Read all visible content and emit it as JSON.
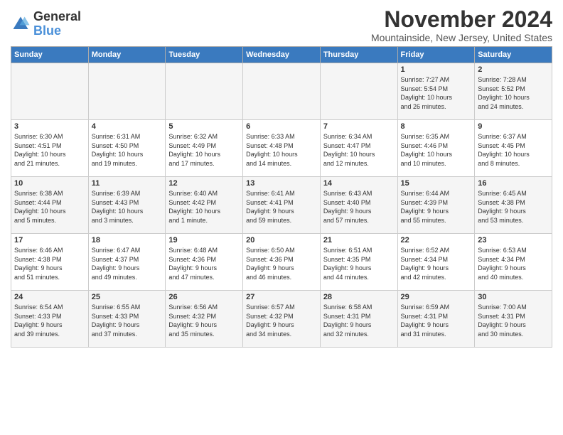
{
  "header": {
    "logo_line1": "General",
    "logo_line2": "Blue",
    "month": "November 2024",
    "location": "Mountainside, New Jersey, United States"
  },
  "days_of_week": [
    "Sunday",
    "Monday",
    "Tuesday",
    "Wednesday",
    "Thursday",
    "Friday",
    "Saturday"
  ],
  "weeks": [
    [
      {
        "day": "",
        "info": ""
      },
      {
        "day": "",
        "info": ""
      },
      {
        "day": "",
        "info": ""
      },
      {
        "day": "",
        "info": ""
      },
      {
        "day": "",
        "info": ""
      },
      {
        "day": "1",
        "info": "Sunrise: 7:27 AM\nSunset: 5:54 PM\nDaylight: 10 hours\nand 26 minutes."
      },
      {
        "day": "2",
        "info": "Sunrise: 7:28 AM\nSunset: 5:52 PM\nDaylight: 10 hours\nand 24 minutes."
      }
    ],
    [
      {
        "day": "3",
        "info": "Sunrise: 6:30 AM\nSunset: 4:51 PM\nDaylight: 10 hours\nand 21 minutes."
      },
      {
        "day": "4",
        "info": "Sunrise: 6:31 AM\nSunset: 4:50 PM\nDaylight: 10 hours\nand 19 minutes."
      },
      {
        "day": "5",
        "info": "Sunrise: 6:32 AM\nSunset: 4:49 PM\nDaylight: 10 hours\nand 17 minutes."
      },
      {
        "day": "6",
        "info": "Sunrise: 6:33 AM\nSunset: 4:48 PM\nDaylight: 10 hours\nand 14 minutes."
      },
      {
        "day": "7",
        "info": "Sunrise: 6:34 AM\nSunset: 4:47 PM\nDaylight: 10 hours\nand 12 minutes."
      },
      {
        "day": "8",
        "info": "Sunrise: 6:35 AM\nSunset: 4:46 PM\nDaylight: 10 hours\nand 10 minutes."
      },
      {
        "day": "9",
        "info": "Sunrise: 6:37 AM\nSunset: 4:45 PM\nDaylight: 10 hours\nand 8 minutes."
      }
    ],
    [
      {
        "day": "10",
        "info": "Sunrise: 6:38 AM\nSunset: 4:44 PM\nDaylight: 10 hours\nand 5 minutes."
      },
      {
        "day": "11",
        "info": "Sunrise: 6:39 AM\nSunset: 4:43 PM\nDaylight: 10 hours\nand 3 minutes."
      },
      {
        "day": "12",
        "info": "Sunrise: 6:40 AM\nSunset: 4:42 PM\nDaylight: 10 hours\nand 1 minute."
      },
      {
        "day": "13",
        "info": "Sunrise: 6:41 AM\nSunset: 4:41 PM\nDaylight: 9 hours\nand 59 minutes."
      },
      {
        "day": "14",
        "info": "Sunrise: 6:43 AM\nSunset: 4:40 PM\nDaylight: 9 hours\nand 57 minutes."
      },
      {
        "day": "15",
        "info": "Sunrise: 6:44 AM\nSunset: 4:39 PM\nDaylight: 9 hours\nand 55 minutes."
      },
      {
        "day": "16",
        "info": "Sunrise: 6:45 AM\nSunset: 4:38 PM\nDaylight: 9 hours\nand 53 minutes."
      }
    ],
    [
      {
        "day": "17",
        "info": "Sunrise: 6:46 AM\nSunset: 4:38 PM\nDaylight: 9 hours\nand 51 minutes."
      },
      {
        "day": "18",
        "info": "Sunrise: 6:47 AM\nSunset: 4:37 PM\nDaylight: 9 hours\nand 49 minutes."
      },
      {
        "day": "19",
        "info": "Sunrise: 6:48 AM\nSunset: 4:36 PM\nDaylight: 9 hours\nand 47 minutes."
      },
      {
        "day": "20",
        "info": "Sunrise: 6:50 AM\nSunset: 4:36 PM\nDaylight: 9 hours\nand 46 minutes."
      },
      {
        "day": "21",
        "info": "Sunrise: 6:51 AM\nSunset: 4:35 PM\nDaylight: 9 hours\nand 44 minutes."
      },
      {
        "day": "22",
        "info": "Sunrise: 6:52 AM\nSunset: 4:34 PM\nDaylight: 9 hours\nand 42 minutes."
      },
      {
        "day": "23",
        "info": "Sunrise: 6:53 AM\nSunset: 4:34 PM\nDaylight: 9 hours\nand 40 minutes."
      }
    ],
    [
      {
        "day": "24",
        "info": "Sunrise: 6:54 AM\nSunset: 4:33 PM\nDaylight: 9 hours\nand 39 minutes."
      },
      {
        "day": "25",
        "info": "Sunrise: 6:55 AM\nSunset: 4:33 PM\nDaylight: 9 hours\nand 37 minutes."
      },
      {
        "day": "26",
        "info": "Sunrise: 6:56 AM\nSunset: 4:32 PM\nDaylight: 9 hours\nand 35 minutes."
      },
      {
        "day": "27",
        "info": "Sunrise: 6:57 AM\nSunset: 4:32 PM\nDaylight: 9 hours\nand 34 minutes."
      },
      {
        "day": "28",
        "info": "Sunrise: 6:58 AM\nSunset: 4:31 PM\nDaylight: 9 hours\nand 32 minutes."
      },
      {
        "day": "29",
        "info": "Sunrise: 6:59 AM\nSunset: 4:31 PM\nDaylight: 9 hours\nand 31 minutes."
      },
      {
        "day": "30",
        "info": "Sunrise: 7:00 AM\nSunset: 4:31 PM\nDaylight: 9 hours\nand 30 minutes."
      }
    ]
  ]
}
